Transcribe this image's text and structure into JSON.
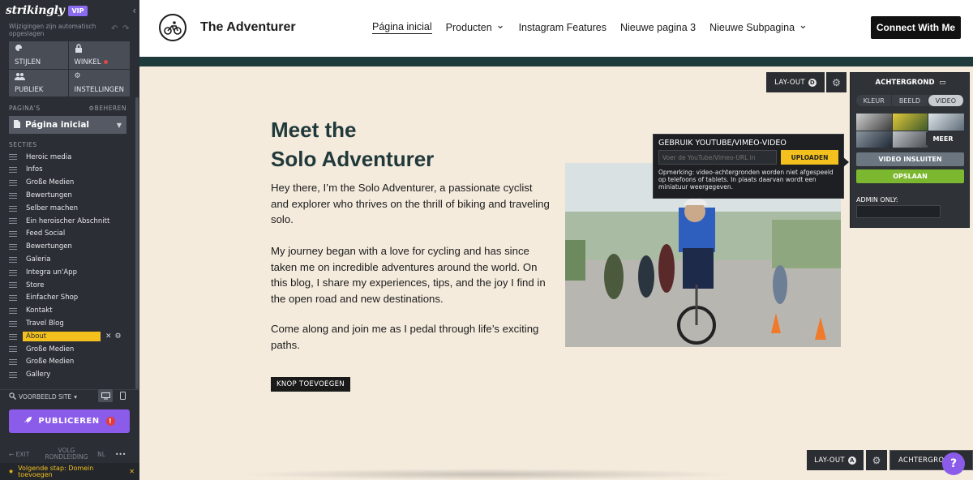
{
  "sidebar": {
    "brand": "strikingly",
    "vip": "VIP",
    "autosave": "Wijzigingen zijn automatisch opgeslagen",
    "grid": [
      {
        "label": "STIJLEN",
        "icon": "palette-icon"
      },
      {
        "label": "WINKEL",
        "icon": "lock-icon"
      },
      {
        "label": "PUBLIEK",
        "icon": "people-icon"
      },
      {
        "label": "INSTELLINGEN",
        "icon": "gear-icon"
      }
    ],
    "pages_label": "PAGINA'S",
    "manage_label": "BEHEREN",
    "current_page": "Página inicial",
    "sections_label": "SECTIES",
    "sections": [
      "Heroic media",
      "Infos",
      "Große Medien",
      "Bewertungen",
      "Selber machen",
      "Ein heroischer Abschnitt",
      "Feed Social",
      "Bewertungen",
      "Galeria",
      "Integra un'App",
      "Store",
      "Einfacher Shop",
      "Kontakt",
      "Travel Blog",
      "About",
      "Große Medien",
      "Große Medien",
      "Gallery"
    ],
    "active_section": "About",
    "preview_label": "VOORBEELD SITE",
    "publish_label": "PUBLICEREN",
    "publish_warning": "!",
    "exit_label": "EXIT",
    "tour_label": "VOLG RONDLEIDING",
    "lang_label": "NL",
    "more_label": "•••",
    "next_step": "Volgende stap: Domein toevoegen"
  },
  "header": {
    "site_title": "The Adventurer",
    "nav": [
      {
        "label": "Página inicial",
        "active": true,
        "dropdown": false
      },
      {
        "label": "Producten",
        "active": false,
        "dropdown": true
      },
      {
        "label": "Instagram Features",
        "active": false,
        "dropdown": false
      },
      {
        "label": "Nieuwe pagina 3",
        "active": false,
        "dropdown": false
      },
      {
        "label": "Nieuwe Subpagina",
        "active": false,
        "dropdown": true
      }
    ],
    "cta": "Connect With Me"
  },
  "main": {
    "heading_line1": "Meet the",
    "heading_line2": "Solo Adventurer",
    "paragraphs": [
      "Hey there, I’m the Solo Adventurer, a passionate cyclist and explorer who thrives on the thrill of biking and traveling solo.",
      "My journey began with a love for cycling and has since taken me on incredible adventures around the world. On this blog, I share my experiences, tips, and the joy I find in the open road and new destinations.",
      "Come along and join me as I pedal through life’s exciting paths."
    ],
    "add_button": "KNOP TOEVOEGEN"
  },
  "editor": {
    "layout_label": "LAY-OUT",
    "layout_badge_top": "D",
    "layout_badge_bottom": "A",
    "background_label": "ACHTERGROND",
    "bg_tabs": [
      "KLEUR",
      "BEELD",
      "VIDEO"
    ],
    "bg_selected_tab": "VIDEO",
    "more_label": "MEER",
    "embed_label": "VIDEO INSLUITEN",
    "save_label": "OPSLAAN",
    "admin_label": "ADMIN ONLY:",
    "yt_title": "GEBRUIK YOUTUBE/VIMEO-VIDEO",
    "yt_placeholder": "Voer de YouTube/Vimeo-URL in",
    "yt_upload": "UPLOADEN",
    "yt_note": "Opmerking: video-achtergronden worden niet afgespeeld op telefoons of tablets. In plaats daarvan wordt een miniatuur weergegeven.",
    "help": "?"
  },
  "colors": {
    "sidebar_bg": "#2b2e34",
    "accent_purple": "#8b5bea",
    "accent_yellow": "#f3c01e",
    "heading_teal": "#21393a",
    "save_green": "#7cb82f"
  }
}
